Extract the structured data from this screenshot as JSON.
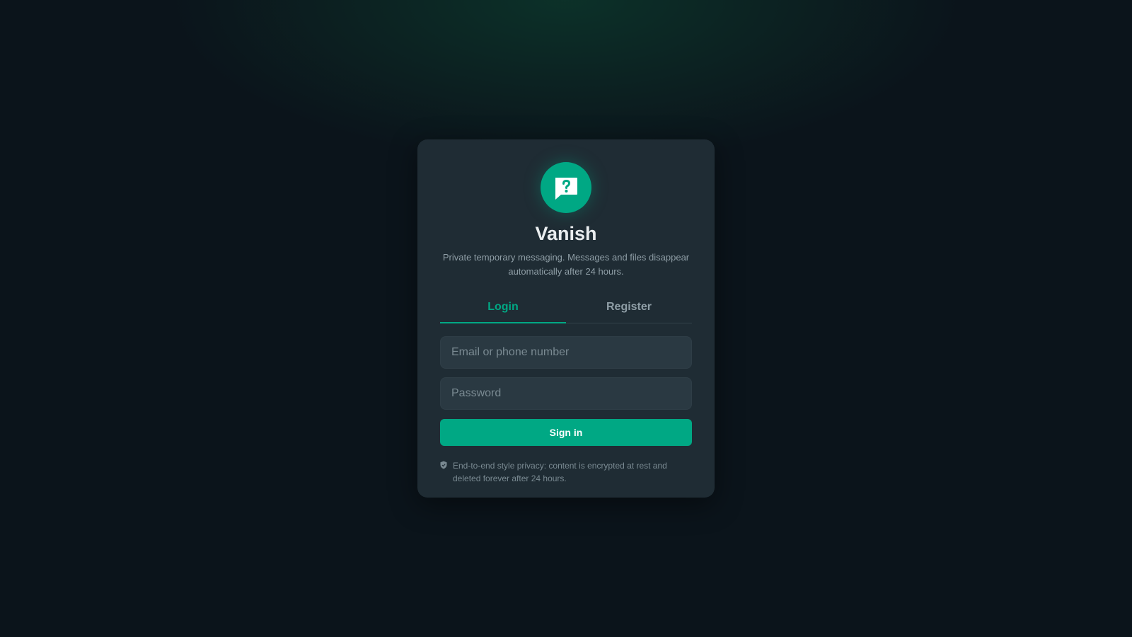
{
  "app": {
    "name": "Vanish",
    "tagline": "Private temporary messaging. Messages and files disappear automatically after 24 hours.",
    "logo_icon": "chat-question-icon"
  },
  "tabs": [
    {
      "label": "Login",
      "active": true
    },
    {
      "label": "Register",
      "active": false
    }
  ],
  "form": {
    "identifier": {
      "value": "",
      "placeholder": "Email or phone number"
    },
    "password": {
      "value": "",
      "placeholder": "Password"
    },
    "submit_label": "Sign in"
  },
  "footer_note": {
    "icon": "shield-icon",
    "text": "End-to-end style privacy: content is encrypted at rest and deleted forever after 24 hours."
  },
  "colors": {
    "accent": "#00a884",
    "background": "#0b141b",
    "card": "#1f2c34",
    "input": "#2a3942"
  }
}
